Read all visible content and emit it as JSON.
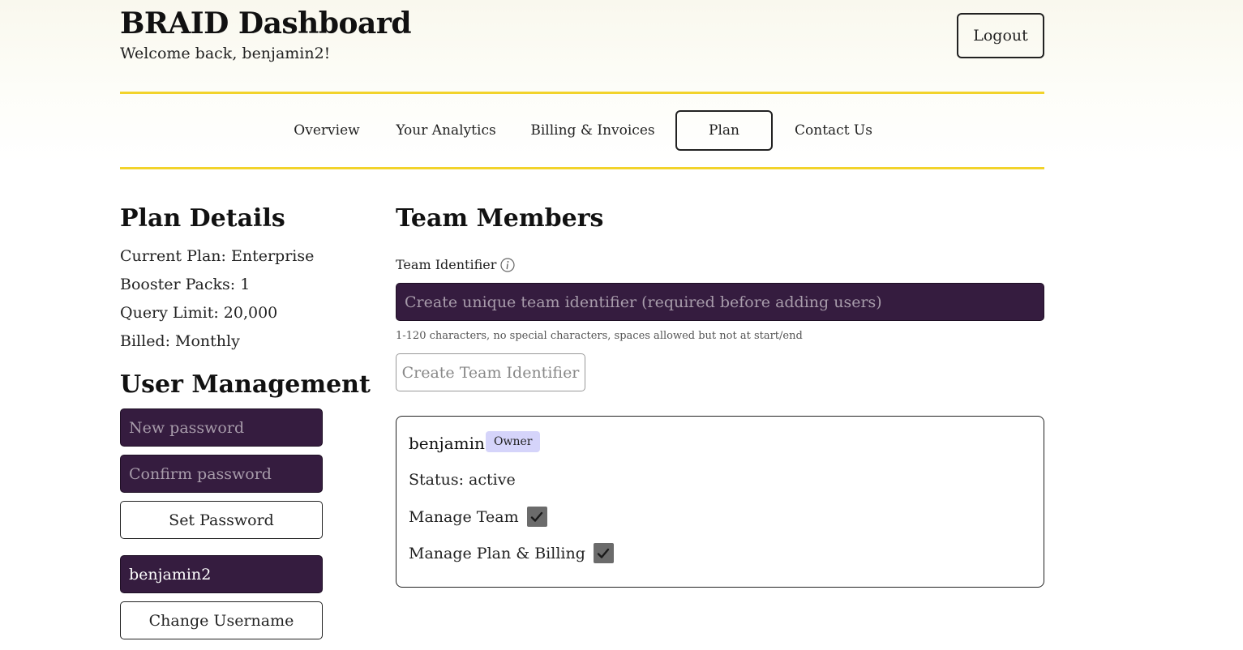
{
  "header": {
    "title": "BRAID Dashboard",
    "welcome": "Welcome back, benjamin2!",
    "logout_label": "Logout"
  },
  "nav": {
    "items": [
      {
        "label": "Overview"
      },
      {
        "label": "Your Analytics"
      },
      {
        "label": "Billing & Invoices"
      },
      {
        "label": "Plan",
        "active": true
      },
      {
        "label": "Contact Us"
      }
    ]
  },
  "plan_details": {
    "title": "Plan Details",
    "current_plan": "Current Plan: Enterprise",
    "booster_packs": "Booster Packs: 1",
    "query_limit": "Query Limit: 20,000",
    "billed": "Billed: Monthly"
  },
  "user_management": {
    "title": "User Management",
    "new_password_placeholder": "New password",
    "confirm_password_placeholder": "Confirm password",
    "set_password_label": "Set Password",
    "username_value": "benjamin2",
    "change_username_label": "Change Username"
  },
  "team": {
    "title": "Team Members",
    "identifier_label": "Team Identifier",
    "identifier_placeholder": "Create unique team identifier (required before adding users)",
    "identifier_hint": "1-120 characters, no special characters, spaces allowed but not at start/end",
    "create_identifier_label": "Create Team Identifier",
    "member": {
      "name": "benjamin",
      "role_badge": "Owner",
      "status": "Status: active",
      "manage_team_label": "Manage Team",
      "manage_team_checked": true,
      "manage_billing_label": "Manage Plan & Billing",
      "manage_billing_checked": true
    }
  },
  "colors": {
    "accent_rule": "#f2d32b",
    "input_bg": "#351c3f",
    "badge_bg": "#d5d4fa",
    "checkbox_fill": "#6b6b6b"
  },
  "icons": {
    "info": "info-circle-icon",
    "check": "checkmark-icon"
  }
}
